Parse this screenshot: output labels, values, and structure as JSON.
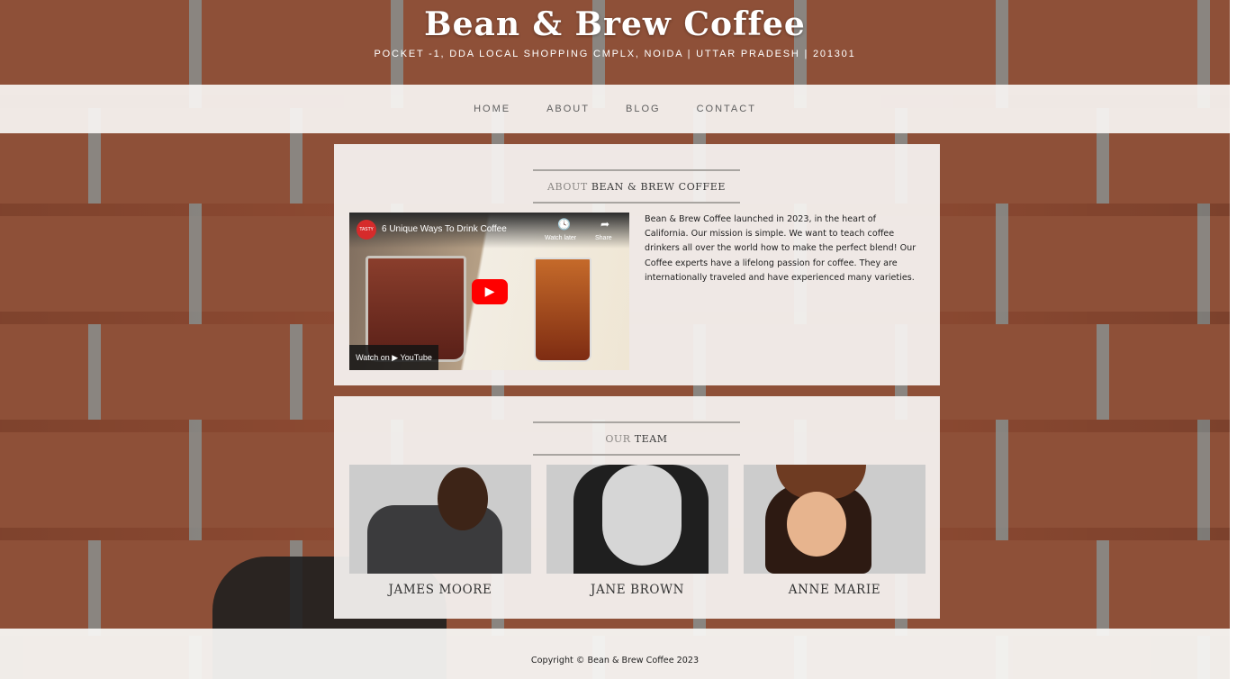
{
  "site": {
    "title": "Bean & Brew Coffee",
    "address": "POCKET -1, DDA LOCAL SHOPPING CMPLX, NOIDA | UTTAR PRADESH | 201301"
  },
  "nav": {
    "items": [
      {
        "label": "HOME"
      },
      {
        "label": "ABOUT"
      },
      {
        "label": "BLOG"
      },
      {
        "label": "CONTACT"
      }
    ]
  },
  "about": {
    "heading_light": "ABOUT",
    "heading_bold": "BEAN & BREW COFFEE",
    "video": {
      "title": "6 Unique Ways To Drink Coffee",
      "channel_badge": "TASTY",
      "watch_later": "Watch later",
      "share": "Share",
      "watch_on": "Watch on ▶ YouTube"
    },
    "text": "Bean & Brew Coffee launched in 2023, in the heart of California. Our mission is simple. We want to teach coffee drinkers all over the world how to make the perfect blend! Our Coffee experts have a lifelong passion for coffee. They are internationally traveled and have experienced many varieties."
  },
  "team": {
    "heading_light": "OUR",
    "heading_bold": "TEAM",
    "members": [
      {
        "name": "JAMES MOORE"
      },
      {
        "name": "JANE BROWN"
      },
      {
        "name": "ANNE MARIE"
      }
    ]
  },
  "footer": {
    "copyright": "Copyright © Bean & Brew Coffee 2023"
  },
  "colors": {
    "brick": "#8e5038",
    "mortar": "#8e8a85",
    "panel": "#f6f4f2",
    "youtube_red": "#ff0000"
  }
}
